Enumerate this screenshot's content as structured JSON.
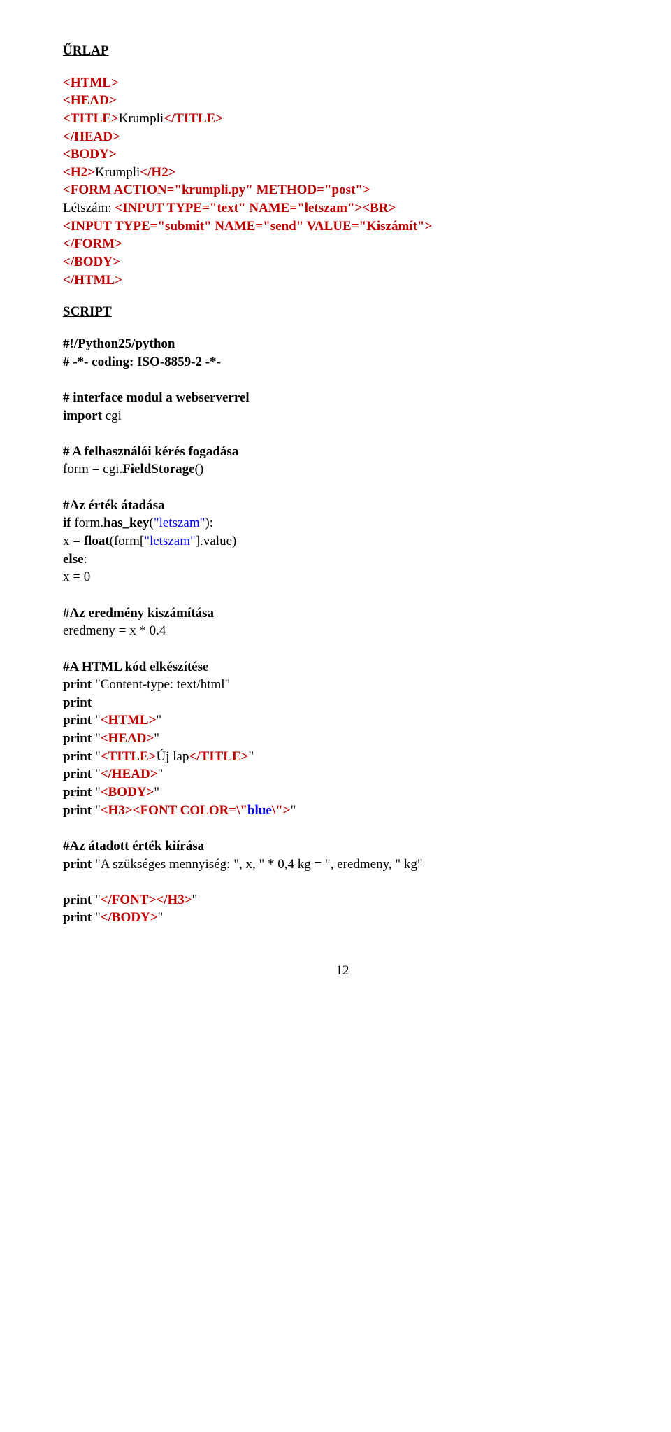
{
  "heading1": "ŰRLAP",
  "code1": {
    "l1": "<HTML>",
    "l2": "<HEAD>",
    "l3a": "<TITLE>",
    "l3b": "Krumpli",
    "l3c": "</TITLE>",
    "l4": "</HEAD>",
    "l5": "<BODY>",
    "l6a": "<H2>",
    "l6b": "Krumpli",
    "l6c": "</H2>",
    "l7": "<FORM ACTION=\"krumpli.py\" METHOD=\"post\">",
    "l8a": "Létszám: ",
    "l8b": "<INPUT TYPE=\"text\" NAME=\"letszam\"><BR>",
    "l9": "<INPUT TYPE=\"submit\" NAME=\"send\" VALUE=\"Kiszámít\">",
    "l10": "</FORM>",
    "l11": "</BODY>",
    "l12": "</HTML>"
  },
  "heading2": "SCRIPT",
  "code2": {
    "l1": "#!/Python25/python",
    "l2": "# -*- coding: ISO-8859-2 -*-",
    "l3": "# interface modul a webserverrel",
    "l4a": "import",
    "l4b": " cgi",
    "l5": "# A felhasználói kérés fogadása",
    "l6a": "form = cgi.",
    "l6b": "FieldStorage",
    "l6c": "()",
    "l7": "#Az érték átadása",
    "l8a": "if",
    "l8b": " form.",
    "l8c": "has_key",
    "l8d": "(",
    "l8e": "\"letszam\"",
    "l8f": "):",
    "l9a": "   x = ",
    "l9b": "float",
    "l9c": "(form[",
    "l9d": "\"letszam\"",
    "l9e": "].value)",
    "l10": "else",
    "l10b": ":",
    "l11": "   x = 0",
    "l12": "#Az eredmény kiszámítása",
    "l13": "eredmeny = x * 0.4",
    "l14": "#A HTML kód elkészítése",
    "l15a": "print",
    "l15b": " \"Content-type: text/html\"",
    "l16": "print",
    "l17a": "print",
    "l17b": " \"",
    "l17c": "<HTML>",
    "l17d": "\"",
    "l18a": "print",
    "l18b": " \"",
    "l18c": "<HEAD>",
    "l18d": "\"",
    "l19a": "print",
    "l19b": " \"",
    "l19c": "<TITLE>",
    "l19d": "Új lap",
    "l19e": "</TITLE>",
    "l19f": "\"",
    "l20a": "print",
    "l20b": " \"",
    "l20c": "</HEAD>",
    "l20d": "\"",
    "l21a": "print",
    "l21b": " \"",
    "l21c": "<BODY>",
    "l21d": "\"",
    "l22a": "print",
    "l22b": " \"",
    "l22c": "<H3><FONT COLOR=\\\"",
    "l22d": "blue",
    "l22e": "\\\">",
    "l22f": "\"",
    "l23": "#Az átadott érték kiírása",
    "l24a": "print",
    "l24b": " \"A szükséges mennyiség: \", x, \" * 0,4 kg = \", eredmeny, \" kg\"",
    "l25a": "print",
    "l25b": " \"",
    "l25c": "</FONT></H3>",
    "l25d": "\"",
    "l26a": "print",
    "l26b": " \"",
    "l26c": "</BODY>",
    "l26d": "\""
  },
  "pagenum": "12"
}
